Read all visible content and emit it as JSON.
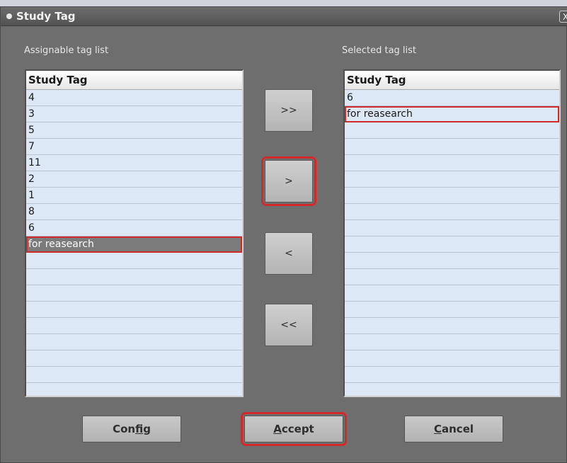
{
  "window": {
    "title": "Study Tag",
    "close_label": "X"
  },
  "assignable": {
    "label": "Assignable tag list",
    "header": "Study Tag",
    "items": [
      "4",
      "3",
      "5",
      "7",
      "11",
      "2",
      "1",
      "8",
      "6",
      "for reasearch"
    ],
    "selected_index": 9,
    "empty_rows": 8
  },
  "selected": {
    "label": "Selected tag list",
    "header": "Study Tag",
    "items": [
      "6",
      "for reasearch"
    ],
    "highlight_index": 1,
    "empty_rows": 16
  },
  "move_buttons": {
    "add_all": ">>",
    "add": ">",
    "remove": "<",
    "remove_all": "<<"
  },
  "actions": {
    "config": "Config",
    "accept": "Accept",
    "cancel": "Cancel"
  },
  "colors": {
    "annotation": "#d02a2a",
    "list_background": "#dce8f6",
    "window_background": "#6e6e6e"
  }
}
